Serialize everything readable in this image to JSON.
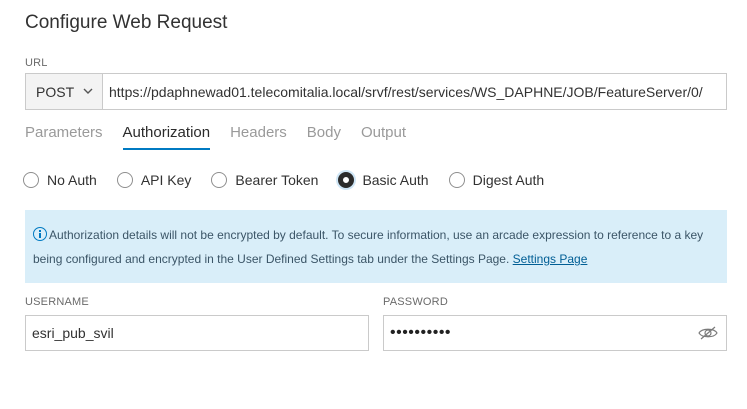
{
  "dialog": {
    "title": "Configure Web Request"
  },
  "url_section": {
    "label": "URL",
    "method": "POST",
    "url": "https://pdaphnewad01.telecomitalia.local/srvf/rest/services/WS_DAPHNE/JOB/FeatureServer/0/"
  },
  "tabs": [
    {
      "label": "Parameters",
      "active": false
    },
    {
      "label": "Authorization",
      "active": true
    },
    {
      "label": "Headers",
      "active": false
    },
    {
      "label": "Body",
      "active": false
    },
    {
      "label": "Output",
      "active": false
    }
  ],
  "auth_options": [
    {
      "label": "No Auth",
      "selected": false
    },
    {
      "label": "API Key",
      "selected": false
    },
    {
      "label": "Bearer Token",
      "selected": false
    },
    {
      "label": "Basic Auth",
      "selected": true
    },
    {
      "label": "Digest Auth",
      "selected": false
    }
  ],
  "notice": {
    "text": "Authorization details will not be encrypted by default. To secure information, use an arcade expression to reference to a key being configured and encrypted in the User Defined Settings tab under the Settings Page.",
    "link": "Settings Page",
    "icon": "info-icon"
  },
  "credentials": {
    "username_label": "USERNAME",
    "username_value": "esri_pub_svil",
    "password_label": "PASSWORD",
    "password_value": "••••••••••"
  },
  "colors": {
    "accent": "#007ac2",
    "notice_bg": "#d9eef9"
  }
}
